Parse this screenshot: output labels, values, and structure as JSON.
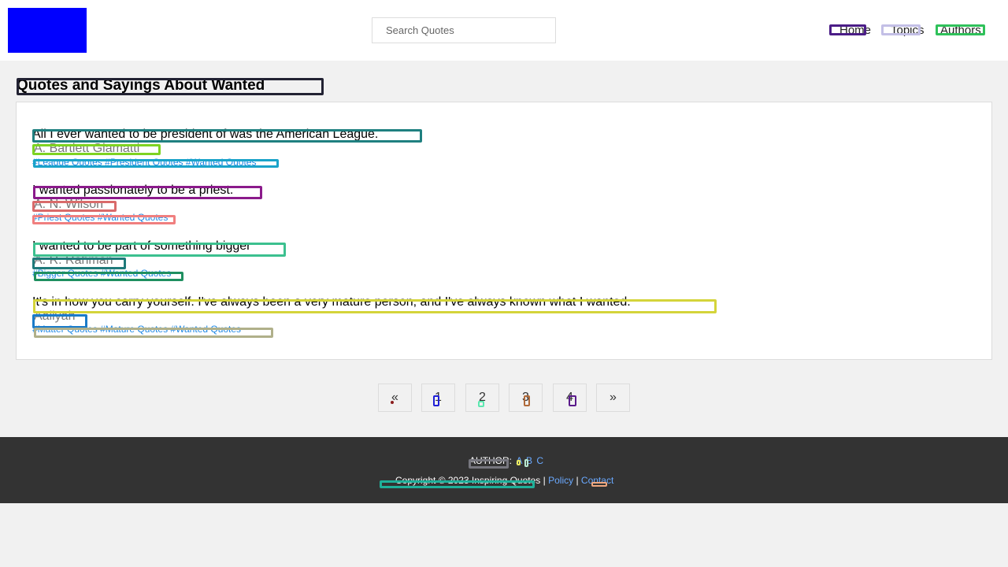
{
  "header": {
    "search_placeholder": "Search Quotes",
    "nav": [
      "Home",
      "Topics",
      "Authors"
    ]
  },
  "main": {
    "title": "Quotes and Sayings About Wanted",
    "quotes": [
      {
        "text": "All I ever wanted to be president of was the American League.",
        "author": "A. Bartlett Giamatti",
        "tags": [
          "#League Quotes",
          "#President Quotes",
          "#Wanted Quotes"
        ]
      },
      {
        "text": "I wanted passionately to be a priest.",
        "author": "A. N. Wilson",
        "tags": [
          "#Priest Quotes",
          "#Wanted Quotes"
        ]
      },
      {
        "text": "I wanted to be part of something bigger",
        "author": "A. R. Rahman",
        "tags": [
          "#Bigger Quotes",
          "#Wanted Quotes"
        ]
      },
      {
        "text": "It's in how you carry yourself. I've always been a very mature person, and I've always known what I wanted.",
        "author": "Aaliyah",
        "tags": [
          "#Matter Quotes",
          "#Mature Quotes",
          "#Wanted Quotes"
        ]
      }
    ]
  },
  "pagination": {
    "prev": "«",
    "pages": [
      "1",
      "2",
      "3",
      "4"
    ],
    "next": "»"
  },
  "footer": {
    "author_label": "AUTHOR:",
    "letters": [
      "A",
      "B",
      "C"
    ],
    "copyright": "Copyright © 2023 Inspiring Quotes",
    "separator": "|",
    "policy": "Policy",
    "contact": "Contact"
  },
  "colors": {
    "logo": "#0000ff",
    "footer_bg": "#333333",
    "link": "#1e88e5"
  }
}
